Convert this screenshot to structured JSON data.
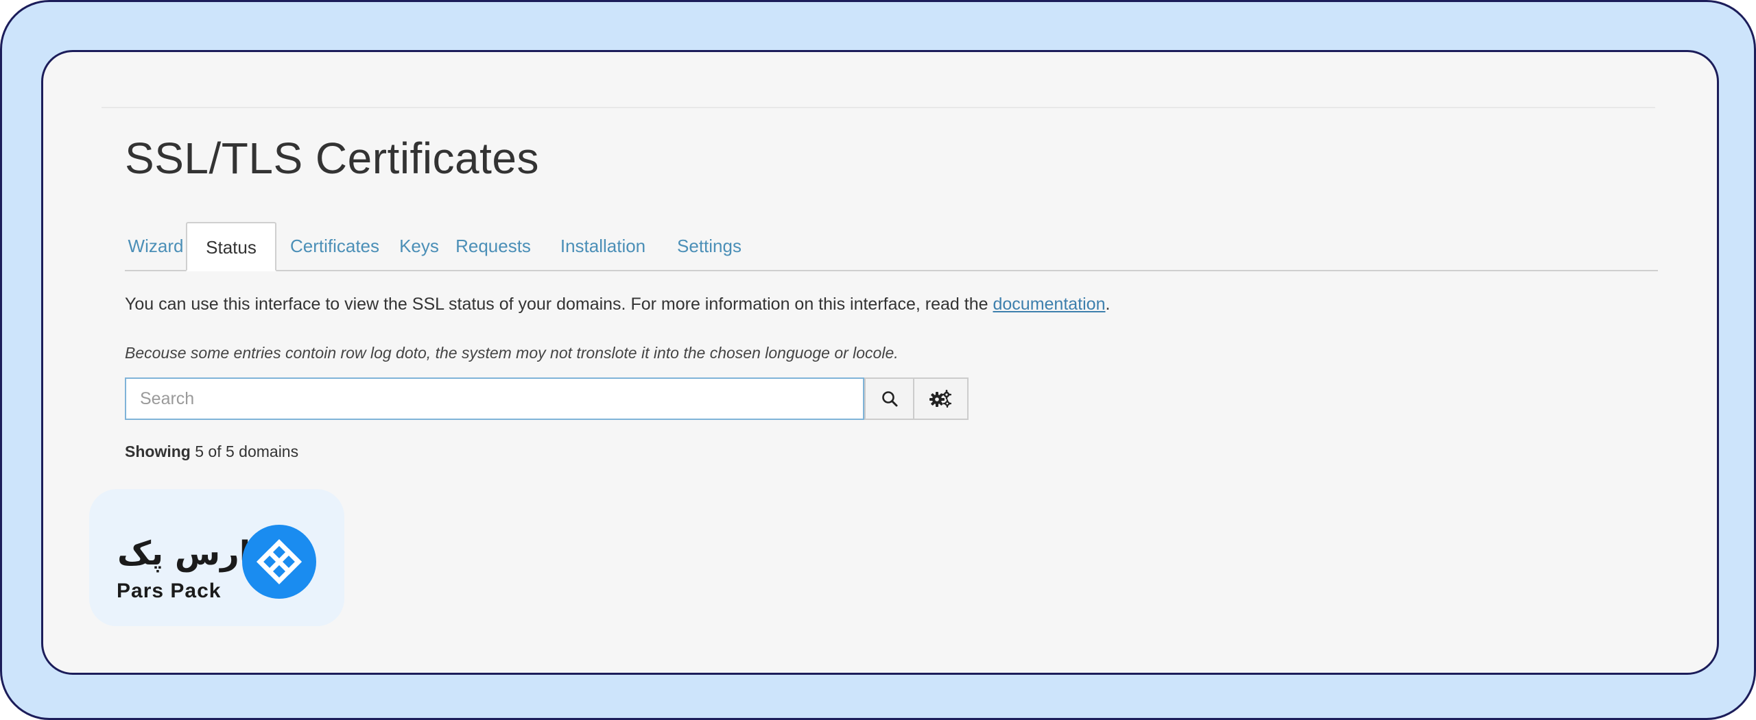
{
  "page": {
    "title": "SSL/TLS Certificates",
    "tabs": [
      {
        "label": "Wizard",
        "active": false
      },
      {
        "label": "Status",
        "active": true
      },
      {
        "label": "Certificates",
        "active": false
      },
      {
        "label": "Keys",
        "active": false
      },
      {
        "label": "Requests",
        "active": false
      },
      {
        "label": "Installation",
        "active": false
      },
      {
        "label": "Settings",
        "active": false
      }
    ],
    "intro_text": "You can use this interface to view the SSL status of your domains. For more information on this interface, read the ",
    "intro_link": "documentation",
    "intro_end": ".",
    "note": "Becouse some entries contoin row log doto, the system moy not tronslote it into the chosen longuoge or locole.",
    "search": {
      "placeholder": "Search",
      "value": ""
    },
    "showing_label": "Showing",
    "showing_count": "5 of 5 domains"
  },
  "brand": {
    "name_fa": "پارس پک",
    "name_en": "Pars Pack",
    "accent": "#1a8cf0"
  },
  "colors": {
    "frame": "#cde4fb",
    "frame_border": "#1c1d5a",
    "link": "#4b8fb7"
  },
  "icons": {
    "search_button": "search-icon",
    "settings_button": "gears-icon",
    "logo": "parspack-diamond-logo"
  }
}
